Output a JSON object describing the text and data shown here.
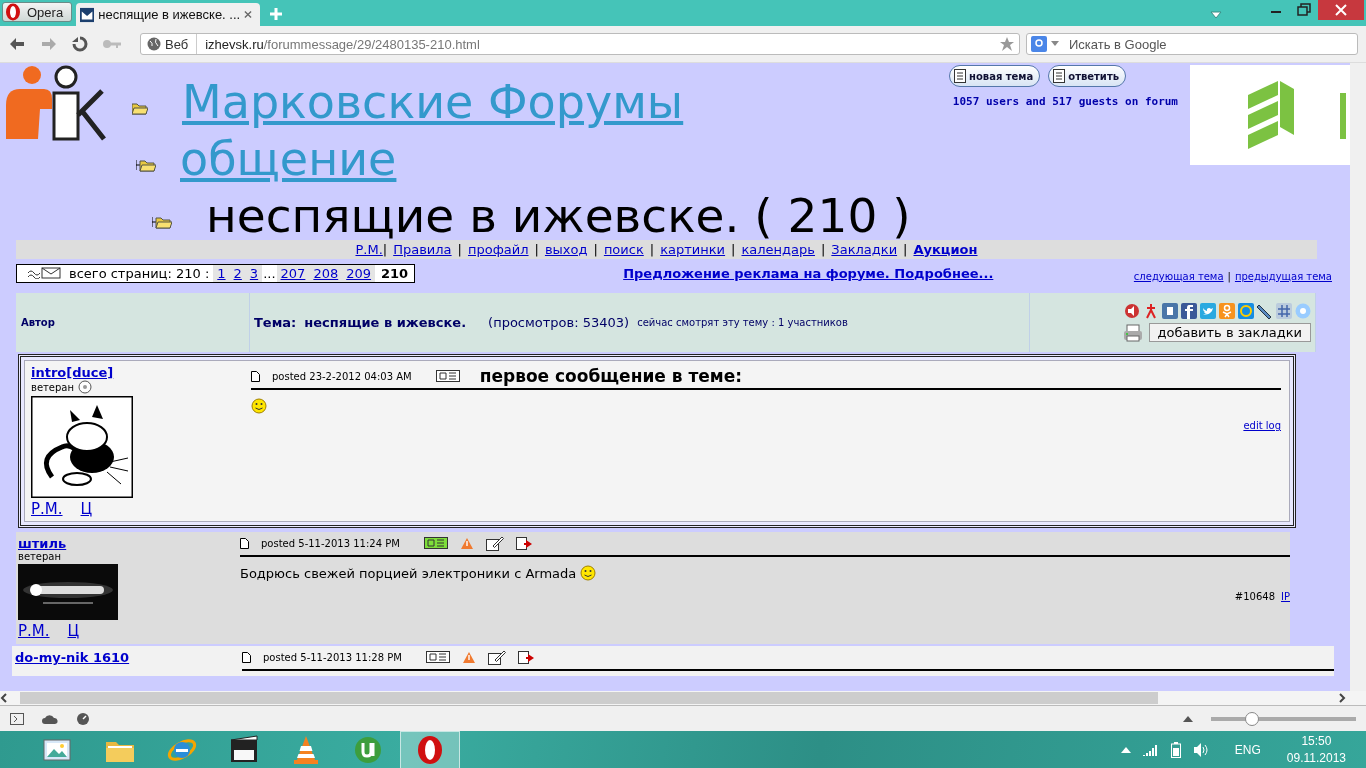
{
  "browser": {
    "menu_label": "Opera",
    "tabs": [
      {
        "label": "неспящие в ижевске. ...",
        "selected": true
      }
    ],
    "address": {
      "badge": "Веб",
      "host": "izhevsk.ru",
      "path": "/forummessage/29/2480135-210.html"
    },
    "search": {
      "placeholder": "Искать в Google"
    }
  },
  "forum": {
    "breadcrumbs": [
      {
        "label": "Марковские Форумы",
        "kind": "link"
      },
      {
        "label": "общение",
        "kind": "link"
      },
      {
        "label": "неспящие в ижевске. ( 210 )",
        "kind": "current"
      }
    ],
    "header_buttons": [
      "новая тема",
      "ответить"
    ],
    "online": "1057 users and 517 guests on forum",
    "nav_separator": "|",
    "nav": [
      {
        "label": "Р.М.",
        "bold": false
      },
      {
        "label": "Правила",
        "bold": false
      },
      {
        "label": "профайл",
        "bold": false
      },
      {
        "label": "выход",
        "bold": false
      },
      {
        "label": "поиск",
        "bold": false
      },
      {
        "label": "картинки",
        "bold": false
      },
      {
        "label": "календарь",
        "bold": false
      },
      {
        "label": "Закладки",
        "bold": false
      },
      {
        "label": "Аукцион",
        "bold": true
      }
    ],
    "pager": {
      "label": "всего страниц: 210 :",
      "pages": [
        {
          "label": "1",
          "selected": false
        },
        {
          "label": "2",
          "selected": false
        },
        {
          "label": "3",
          "selected": false
        },
        {
          "label": "...",
          "kind": "gap"
        },
        {
          "label": "207",
          "selected": false
        },
        {
          "label": "208",
          "selected": false
        },
        {
          "label": "209",
          "selected": false
        },
        {
          "label": "210",
          "selected": true
        }
      ]
    },
    "promo": "Предложение реклама на форуме. Подробнее...",
    "topic_links": [
      "следующая тема",
      "предыдущая тема"
    ],
    "topic_links_separator": "|",
    "table": {
      "author_heading": "Автор",
      "topic_label": "Тема:",
      "topic_title": "неспящие в ижевске.",
      "views": "(просмотров: 53403)",
      "watching": "сейчас смотрят эту тему : 1 участников",
      "bookmark_button": "добавить в закладки"
    },
    "posts": [
      {
        "kind": "first",
        "author": "intro[duce]",
        "rank": "ветеран",
        "posted": "posted 23-2-2012 04:03 AM",
        "online": false,
        "actions": [
          {
            "kind": "quote"
          }
        ],
        "heading": "первое сообщение в теме:",
        "smiley": true,
        "edit_log": "edit log",
        "links": [
          "Р.М.",
          "Ц"
        ]
      },
      {
        "kind": "reply",
        "author": "штиль",
        "rank": "ветеран",
        "posted": "posted 5-11-2013 11:24 PM",
        "online": true,
        "actions": [
          {
            "kind": "quote"
          },
          {
            "kind": "warn"
          },
          {
            "kind": "edit"
          },
          {
            "kind": "reply"
          }
        ],
        "body": "Бодрюсь свежей порцией электроники с Armada",
        "smiley": true,
        "number": "#10648",
        "ip": "IP",
        "links": [
          "Р.М.",
          "Ц"
        ]
      },
      {
        "kind": "cut",
        "author": "do-my-nik 1610",
        "posted": "posted 5-11-2013 11:28 PM",
        "online": false,
        "actions": [
          {
            "kind": "quote"
          },
          {
            "kind": "warn"
          },
          {
            "kind": "edit"
          },
          {
            "kind": "reply"
          }
        ]
      }
    ]
  },
  "status": {
    "zoom": {
      "level": 0.28
    }
  },
  "taskbar": {
    "apps": [
      {
        "kind": "gallery",
        "selected": false
      },
      {
        "kind": "folder",
        "selected": false
      },
      {
        "kind": "swirl",
        "selected": false
      },
      {
        "kind": "film",
        "selected": false
      },
      {
        "kind": "cone",
        "selected": false
      },
      {
        "kind": "torrent",
        "selected": false
      },
      {
        "kind": "opera",
        "selected": true
      }
    ],
    "language": "ENG",
    "time": "15:50",
    "date": "09.11.2013"
  }
}
